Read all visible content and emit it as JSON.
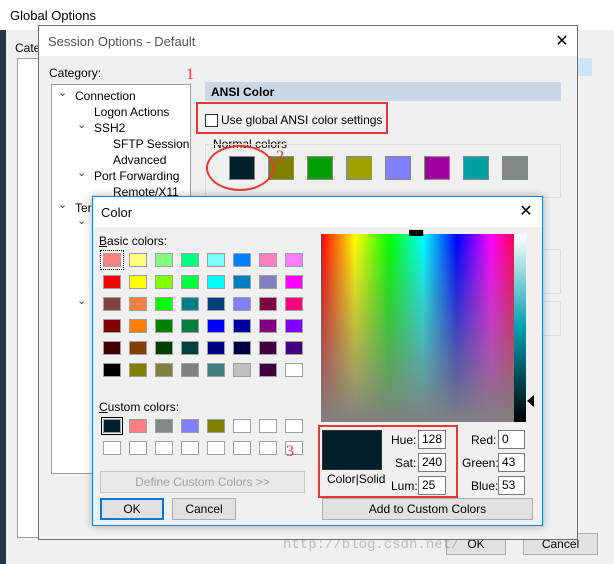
{
  "global_window": {
    "title": "Global Options",
    "cate_label": "Cate"
  },
  "session_window": {
    "title": "Session Options - Default",
    "category_label": "Category:",
    "tree": [
      {
        "label": "Connection",
        "level": 0,
        "expander": "⌄"
      },
      {
        "label": "Logon Actions",
        "level": 1
      },
      {
        "label": "SSH2",
        "level": 1,
        "expander": "⌄"
      },
      {
        "label": "SFTP Session",
        "level": 2
      },
      {
        "label": "Advanced",
        "level": 2
      },
      {
        "label": "Port Forwarding",
        "level": 1,
        "expander": "⌄"
      },
      {
        "label": "Remote/X11",
        "level": 2
      },
      {
        "label": "Terminal",
        "level": 0,
        "expander": "⌄"
      }
    ],
    "ansi_header": "ANSI Color",
    "use_global_checkbox": "Use global ANSI color settings",
    "normal_colors_label": "Normal colors",
    "normal_colors": [
      "#00202b",
      "#808000",
      "#00a000",
      "#a0a000",
      "#8080ff",
      "#a000a0",
      "#00a0a0",
      "#808888"
    ],
    "ok": "OK",
    "cancel": "Cancel"
  },
  "annotations": {
    "one": "1",
    "two": "2",
    "three": "3"
  },
  "color_dialog": {
    "title": "Color",
    "basic_colors_label": "Basic colors:",
    "basic_colors": [
      "#ff8080",
      "#ffff80",
      "#80ff80",
      "#00ff80",
      "#80ffff",
      "#0080ff",
      "#ff80c0",
      "#ff80ff",
      "#ff0000",
      "#ffff00",
      "#80ff00",
      "#00ff40",
      "#00ffff",
      "#0080c0",
      "#8080c0",
      "#ff00ff",
      "#804040",
      "#ff8040",
      "#00ff00",
      "#008080",
      "#004080",
      "#8080ff",
      "#800040",
      "#ff0080",
      "#800000",
      "#ff8000",
      "#008000",
      "#008040",
      "#0000ff",
      "#0000a0",
      "#800080",
      "#8000ff",
      "#400000",
      "#804000",
      "#004000",
      "#004040",
      "#000080",
      "#000040",
      "#400040",
      "#400080",
      "#000000",
      "#808000",
      "#808040",
      "#808080",
      "#408080",
      "#c0c0c0",
      "#400040",
      "#ffffff"
    ],
    "custom_colors_label": "Custom colors:",
    "custom_colors": [
      "#00202b",
      "#ff8080",
      "#808888",
      "#8080ff",
      "#808000",
      "#ffffff",
      "#ffffff",
      "#ffffff",
      "#ffffff",
      "#ffffff",
      "#ffffff",
      "#ffffff",
      "#ffffff",
      "#ffffff",
      "#ffffff",
      "#ffffff"
    ],
    "define_custom": "Define Custom Colors >>",
    "ok": "OK",
    "cancel": "Cancel",
    "color_solid_label": "Color|Solid",
    "selected_color": "#00202b",
    "hue_label": "Hue:",
    "hue_value": "128",
    "sat_label": "Sat:",
    "sat_value": "240",
    "lum_label": "Lum:",
    "lum_value": "25",
    "red_label": "Red:",
    "red_value": "0",
    "green_label": "Green:",
    "green_value": "43",
    "blue_label": "Blue:",
    "blue_value": "53",
    "add_custom": "Add to Custom Colors"
  },
  "bottom_buttons": {
    "ok": "OK",
    "cancel": "Cancel"
  },
  "watermark": "http://blog.csdn.net/"
}
